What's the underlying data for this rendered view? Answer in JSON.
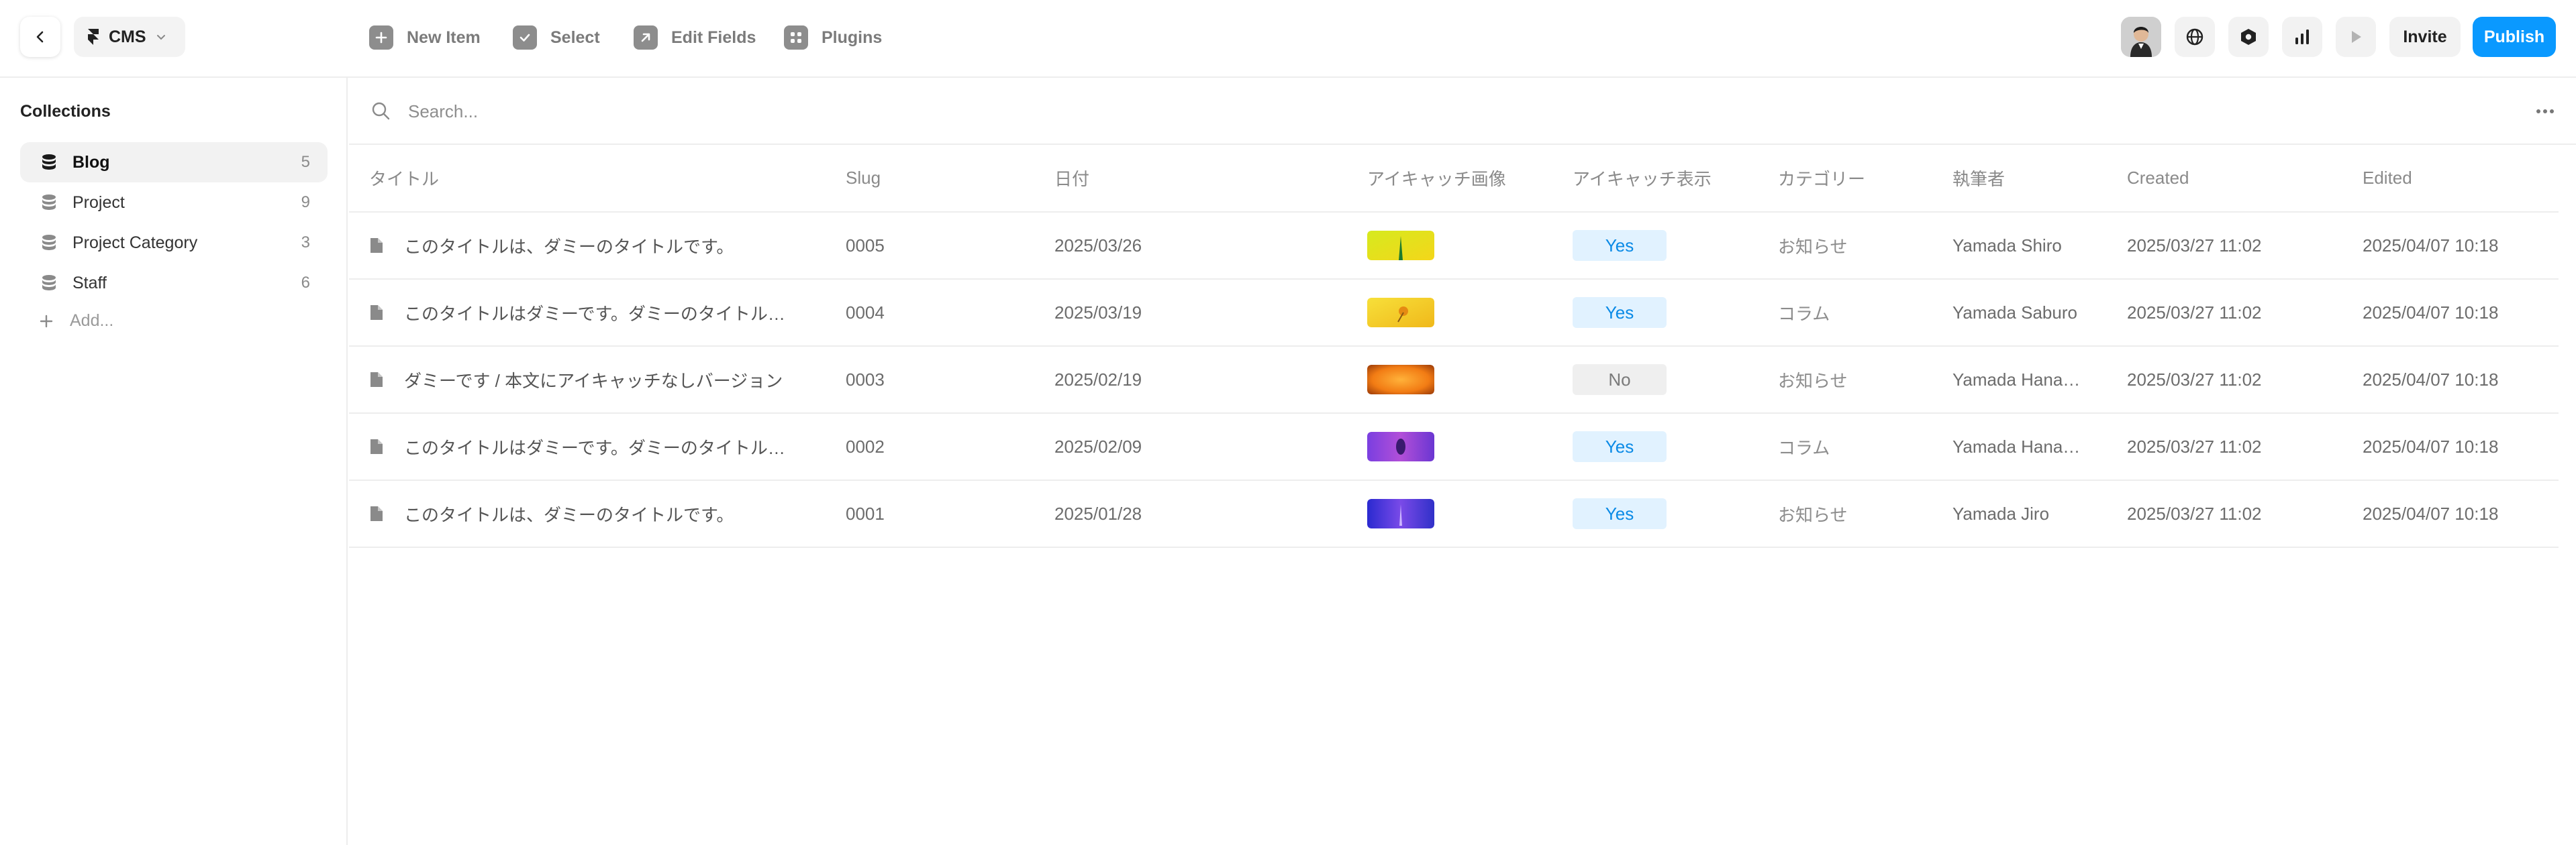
{
  "topbar": {
    "project_label": "CMS",
    "tools": [
      {
        "label": "New Item",
        "icon": "plus-icon"
      },
      {
        "label": "Select",
        "icon": "checkbox-icon"
      },
      {
        "label": "Edit Fields",
        "icon": "arrow-up-right-icon"
      },
      {
        "label": "Plugins",
        "icon": "grid-icon"
      }
    ],
    "invite_label": "Invite",
    "publish_label": "Publish",
    "accent_color": "#0a99ff"
  },
  "sidebar": {
    "title": "Collections",
    "items": [
      {
        "label": "Blog",
        "count": "5",
        "active": true
      },
      {
        "label": "Project",
        "count": "9",
        "active": false
      },
      {
        "label": "Project Category",
        "count": "3",
        "active": false
      },
      {
        "label": "Staff",
        "count": "6",
        "active": false
      }
    ],
    "add_label": "Add..."
  },
  "search": {
    "placeholder": "Search..."
  },
  "table": {
    "columns": [
      "タイトル",
      "Slug",
      "日付",
      "アイキャッチ画像",
      "アイキャッチ表示",
      "カテゴリー",
      "執筆者",
      "Created",
      "Edited"
    ],
    "rows": [
      {
        "title": "このタイトルは、ダミーのタイトルです。",
        "slug": "0005",
        "date": "2025/03/26",
        "thumb": "green-sprout",
        "show": "Yes",
        "category": "お知らせ",
        "author": "Yamada Shiro",
        "created": "2025/03/27 11:02",
        "edited": "2025/04/07 10:18"
      },
      {
        "title": "このタイトルはダミーです。ダミーのタイトル…",
        "slug": "0004",
        "date": "2025/03/19",
        "thumb": "yellow-flower",
        "show": "Yes",
        "category": "コラム",
        "author": "Yamada Saburo",
        "created": "2025/03/27 11:02",
        "edited": "2025/04/07 10:18"
      },
      {
        "title": "ダミーです / 本文にアイキャッチなしバージョン",
        "slug": "0003",
        "date": "2025/02/19",
        "thumb": "orange-flower",
        "show": "No",
        "category": "お知らせ",
        "author": "Yamada Hana…",
        "created": "2025/03/27 11:02",
        "edited": "2025/04/07 10:18"
      },
      {
        "title": "このタイトルはダミーです。ダミーのタイトル…",
        "slug": "0002",
        "date": "2025/02/09",
        "thumb": "purple-flower",
        "show": "Yes",
        "category": "コラム",
        "author": "Yamada Hana…",
        "created": "2025/03/27 11:02",
        "edited": "2025/04/07 10:18"
      },
      {
        "title": "このタイトルは、ダミーのタイトルです。",
        "slug": "0001",
        "date": "2025/01/28",
        "thumb": "blue-purple-flower",
        "show": "Yes",
        "category": "お知らせ",
        "author": "Yamada Jiro",
        "created": "2025/03/27 11:02",
        "edited": "2025/04/07 10:18"
      }
    ]
  }
}
